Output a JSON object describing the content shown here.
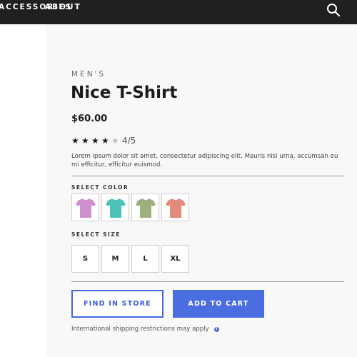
{
  "header": {
    "nav_items": [
      {
        "label": "ACCESSORIES"
      },
      {
        "label": "ABOUT"
      }
    ],
    "search_icon": "search-icon"
  },
  "product": {
    "category": "MEN'S",
    "title": "Nice T-Shirt",
    "price": "$60.00",
    "rating": {
      "value": 4,
      "max": 5,
      "text": "4/5"
    },
    "description": "Lorem ipsum dolor sit amet, consectetur adipiscing elit. Mauris nisi urna, accumsan eu mi efficitur, efficitur euismod."
  },
  "color_picker": {
    "label": "SELECT COLOR",
    "options": [
      {
        "color": "#d18fcf"
      },
      {
        "color": "#4cc2bb"
      },
      {
        "color": "#9caf7c"
      },
      {
        "color": "#e38b7a"
      }
    ]
  },
  "size_picker": {
    "label": "SELECT SIZE",
    "options": [
      {
        "label": "S"
      },
      {
        "label": "M"
      },
      {
        "label": "L"
      },
      {
        "label": "XL"
      }
    ]
  },
  "actions": {
    "find_in_store": "FIND IN STORE",
    "add_to_cart": "ADD TO CART"
  },
  "shipping_note": "International shipping restrictions may apply",
  "colors": {
    "header_bg": "#1f2020",
    "accent": "#4a6ee0",
    "panel_bg": "#f8f8f8"
  }
}
